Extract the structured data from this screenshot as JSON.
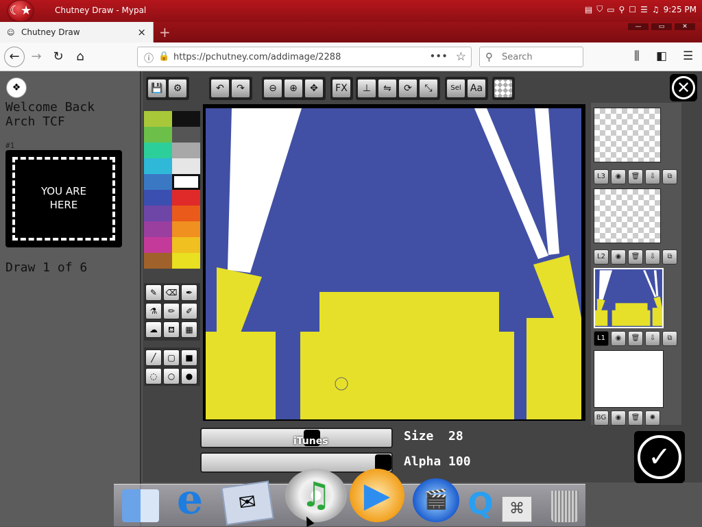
{
  "titlebar": {
    "os_logo_icon": "turkish-flag-icon",
    "window_title": "Chutney Draw - Mypal",
    "clock": "9:25 PM"
  },
  "tabs": [
    {
      "label": "Chutney Draw",
      "close": "×"
    }
  ],
  "newtab": "+",
  "navbar": {
    "url": "https://pchutney.com/addimage/2288",
    "search_placeholder": "Search",
    "page_actions": "•••"
  },
  "sidebar": {
    "welcome_line1": "Welcome Back",
    "welcome_line2": "Arch TCF",
    "rank": "#1",
    "you_are_here": "YOU ARE\nHERE",
    "draw_progress": "Draw 1 of 6"
  },
  "toolbar": {
    "fx_label": "FX",
    "text_label": "Aa",
    "select_label": "Sel"
  },
  "palette": [
    [
      "#a8c83a",
      "#111111"
    ],
    [
      "#6cc04a",
      "#555555"
    ],
    [
      "#2ccf9a",
      "#a8a8a8"
    ],
    [
      "#2fb8d8",
      "#e6e6e6"
    ],
    [
      "#3a78c4",
      "#ffffff"
    ],
    [
      "#3b4fb0",
      "#e02a2a"
    ],
    [
      "#6e46a8",
      "#ea5a1a"
    ],
    [
      "#9a3ea0",
      "#f09020"
    ],
    [
      "#c43a9a",
      "#f0c020"
    ],
    [
      "#a0622a",
      "#e8e020"
    ]
  ],
  "canvas": {
    "background": "#4150a4",
    "shape_color": "#e6e02a",
    "beam_color": "#ffffff"
  },
  "layers": {
    "l3": "L3",
    "l2": "L2",
    "l1": "L1",
    "bg": "BG"
  },
  "brush": {
    "size_label": "Size  28",
    "alpha_label": "Alpha 100",
    "size_value": 28,
    "alpha_value": 100
  },
  "dock": {
    "hover_label": "iTunes",
    "items": [
      "finder",
      "internet-explorer",
      "mail",
      "itunes",
      "media-player",
      "dvd-player",
      "quicktime",
      "system-preferences",
      "trash"
    ]
  }
}
